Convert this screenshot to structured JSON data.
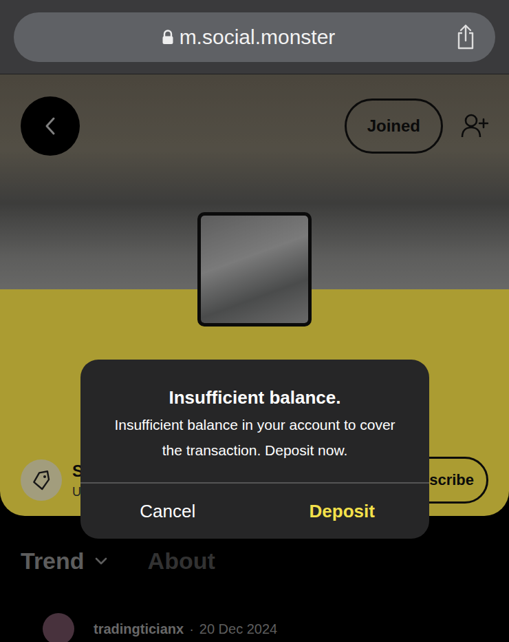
{
  "browser": {
    "url": "m.social.monster"
  },
  "header": {
    "joined_button": "Joined"
  },
  "community": {
    "name_fragments": [
      "S",
      "U"
    ],
    "subscribe_button": "scribe"
  },
  "tabs": [
    {
      "label": "Trend",
      "selected": true,
      "has_dropdown": true
    },
    {
      "label": "About",
      "selected": false,
      "has_dropdown": false
    }
  ],
  "posts": [
    {
      "author": "tradingticianx",
      "separator": "·",
      "date": "20 Dec 2024"
    }
  ],
  "dialog": {
    "title": "Insufficient balance.",
    "message": "Insufficient balance in your account to cover the transaction.  Deposit now.",
    "buttons": [
      {
        "label": "Cancel",
        "primary": false
      },
      {
        "label": "Deposit",
        "primary": true
      }
    ]
  }
}
